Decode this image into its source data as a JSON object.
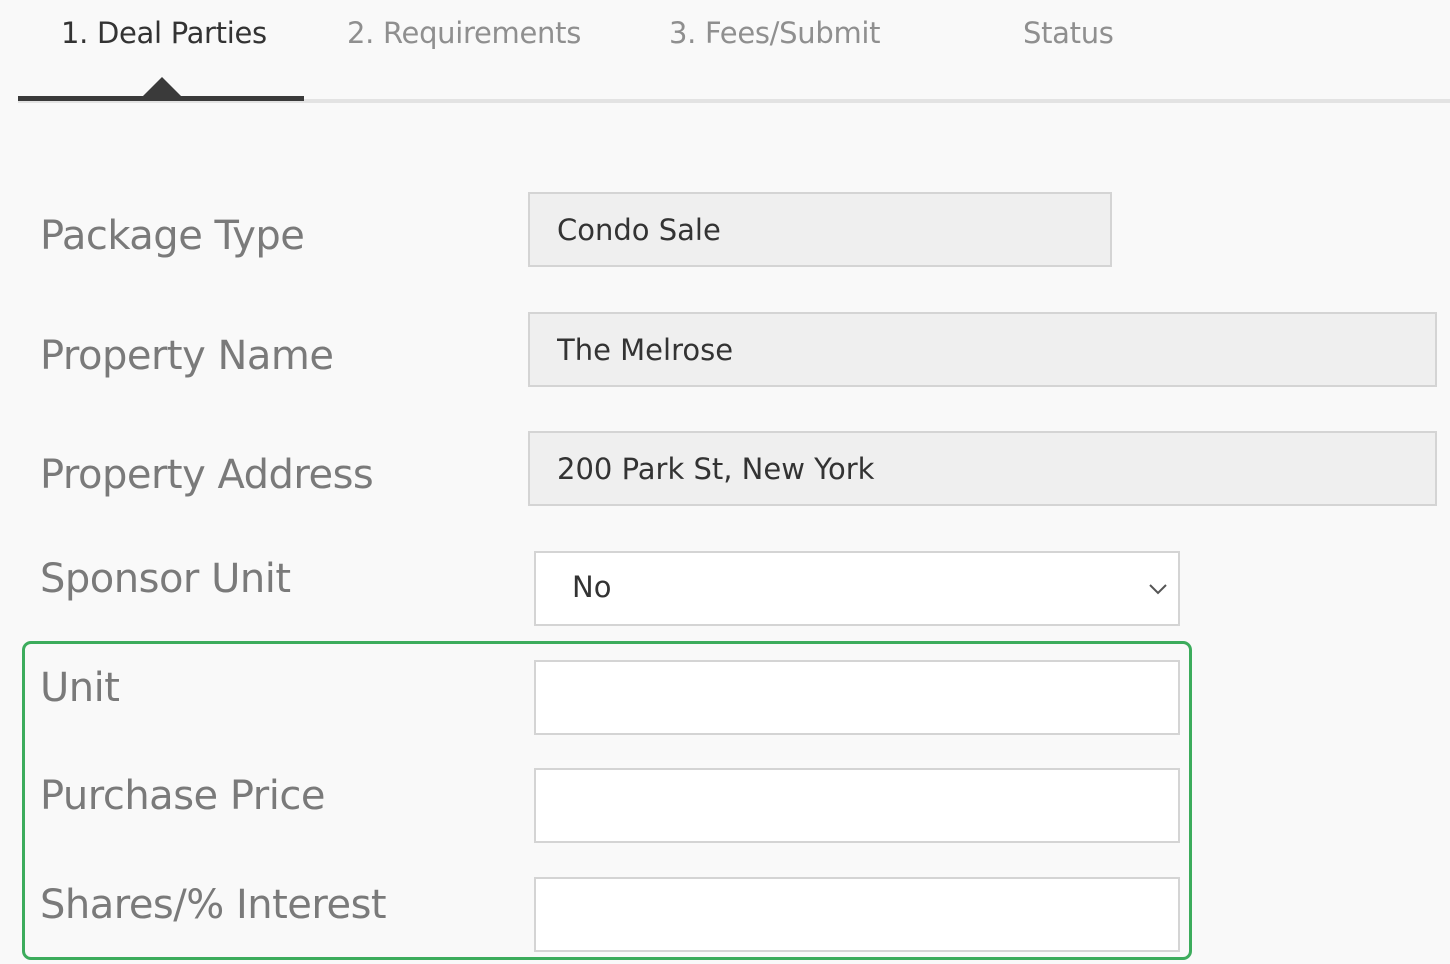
{
  "tabs": [
    {
      "label": "1. Deal Parties",
      "active": true
    },
    {
      "label": "2. Requirements",
      "active": false
    },
    {
      "label": "3. Fees/Submit",
      "active": false
    },
    {
      "label": "Status",
      "active": false
    }
  ],
  "form": {
    "package_type": {
      "label": "Package Type",
      "value": "Condo Sale"
    },
    "property_name": {
      "label": "Property Name",
      "value": "The Melrose"
    },
    "property_address": {
      "label": "Property Address",
      "value": "200 Park St, New York"
    },
    "sponsor_unit": {
      "label": "Sponsor Unit",
      "value": "No",
      "icon": "chevron-down-icon"
    },
    "unit": {
      "label": "Unit",
      "value": ""
    },
    "purchase_price": {
      "label": "Purchase Price",
      "value": ""
    },
    "shares_interest": {
      "label": "Shares/% Interest",
      "value": ""
    }
  },
  "colors": {
    "highlight_border": "#3cac5c",
    "active_tab": "#333333",
    "inactive_tab": "#8f8f8f",
    "readonly_field_bg": "#efefef"
  }
}
